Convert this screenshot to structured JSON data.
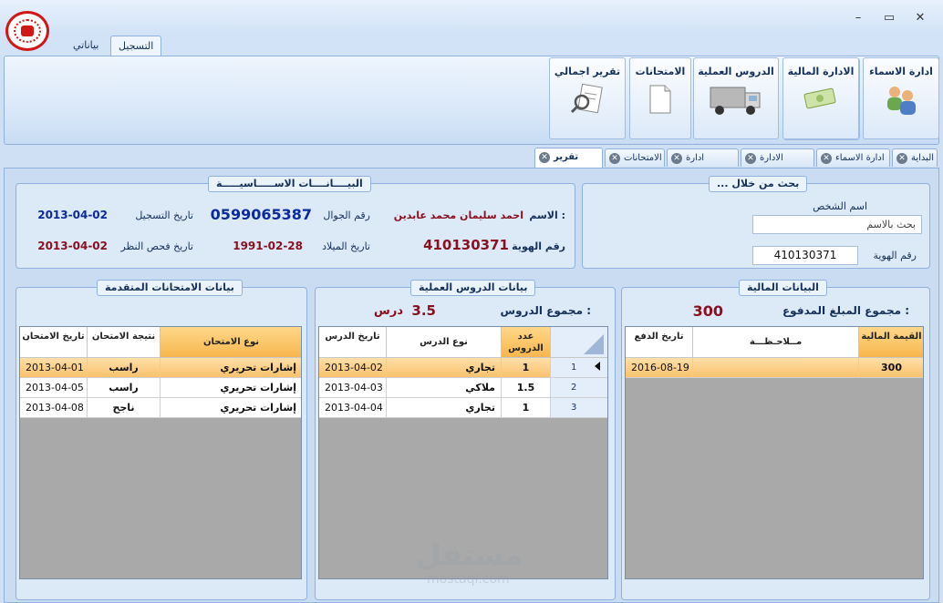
{
  "window": {
    "minimize": "–",
    "maximize": "▭",
    "close": "✕"
  },
  "ribbon_tabs": [
    "التسجيل",
    "بياناتي"
  ],
  "ribbon_buttons": [
    {
      "label": "ادارة الاسماء",
      "icon": "users-icon"
    },
    {
      "label": "الادارة المالية",
      "icon": "money-icon"
    },
    {
      "label": "الدروس العملية",
      "icon": "truck-icon"
    },
    {
      "label": "الامتحانات",
      "icon": "document-icon"
    },
    {
      "label": "تقرير اجمالي",
      "icon": "report-search-icon"
    }
  ],
  "doc_tabs": [
    "البداية",
    "ادارة الاسماء",
    "الادارة المالية",
    "ادارة الدروس",
    "الامتحانات",
    "تقرير كلي"
  ],
  "search": {
    "title": "... بحث من خلال",
    "name_label": "اسم الشخص",
    "name_placeholder": "بحث بالاسم",
    "id_label": "رقم الهوية",
    "id_value": "410130371"
  },
  "basic": {
    "title": "البيــــانــــات الاســـــاسيـــــة",
    "name_label": "الاسم :",
    "name_value": "احمد سليمان محمد عابدين",
    "mobile_label": "رقم الجوال",
    "mobile_value": "0599065387",
    "reg_label": "تاريخ التسجيل",
    "reg_value": "2013-04-02",
    "id_label": "رقم الهوية",
    "id_value": "410130371",
    "birth_label": "تاريخ الميلاد",
    "birth_value": "1991-02-28",
    "exam_label": "تاريخ فحص النظر",
    "exam_value": "2013-04-02"
  },
  "financial": {
    "title": "البيانات المالية",
    "total_label": "مجموع المبلغ المدفوع :",
    "total_value": "300",
    "headers": [
      "القيمة المالية",
      "مــلاحـظـــة",
      "تاريخ الدفع"
    ],
    "rows": [
      {
        "amount": "300",
        "note": "",
        "date": "2016-08-19"
      }
    ]
  },
  "lessons": {
    "title": "بيانات الدروس العملية",
    "total_label": "مجموع الدروس :",
    "total_value": "3.5",
    "total_unit": "درس",
    "headers": [
      "عدد الدروس",
      "نوع الدرس",
      "تاريخ الدرس"
    ],
    "rows": [
      {
        "num": "1",
        "count": "1",
        "type": "تجاري",
        "date": "2013-04-02"
      },
      {
        "num": "2",
        "count": "1.5",
        "type": "ملاكي",
        "date": "2013-04-03"
      },
      {
        "num": "3",
        "count": "1",
        "type": "تجاري",
        "date": "2013-04-04"
      }
    ]
  },
  "exams": {
    "title": "بيانات الامتحانات المتقدمة",
    "headers": [
      "نوع الامتحان",
      "نتيجة الامتحان",
      "تاريخ الامتحان"
    ],
    "rows": [
      {
        "type": "إشارات تحريري",
        "result": "راسب",
        "date": "2013-04-01"
      },
      {
        "type": "إشارات تحريري",
        "result": "راسب",
        "date": "2013-04-05"
      },
      {
        "type": "إشارات تحريري",
        "result": "ناجح",
        "date": "2013-04-08"
      }
    ]
  },
  "watermark": {
    "main": "مستقل",
    "sub": "mostaql.com"
  }
}
